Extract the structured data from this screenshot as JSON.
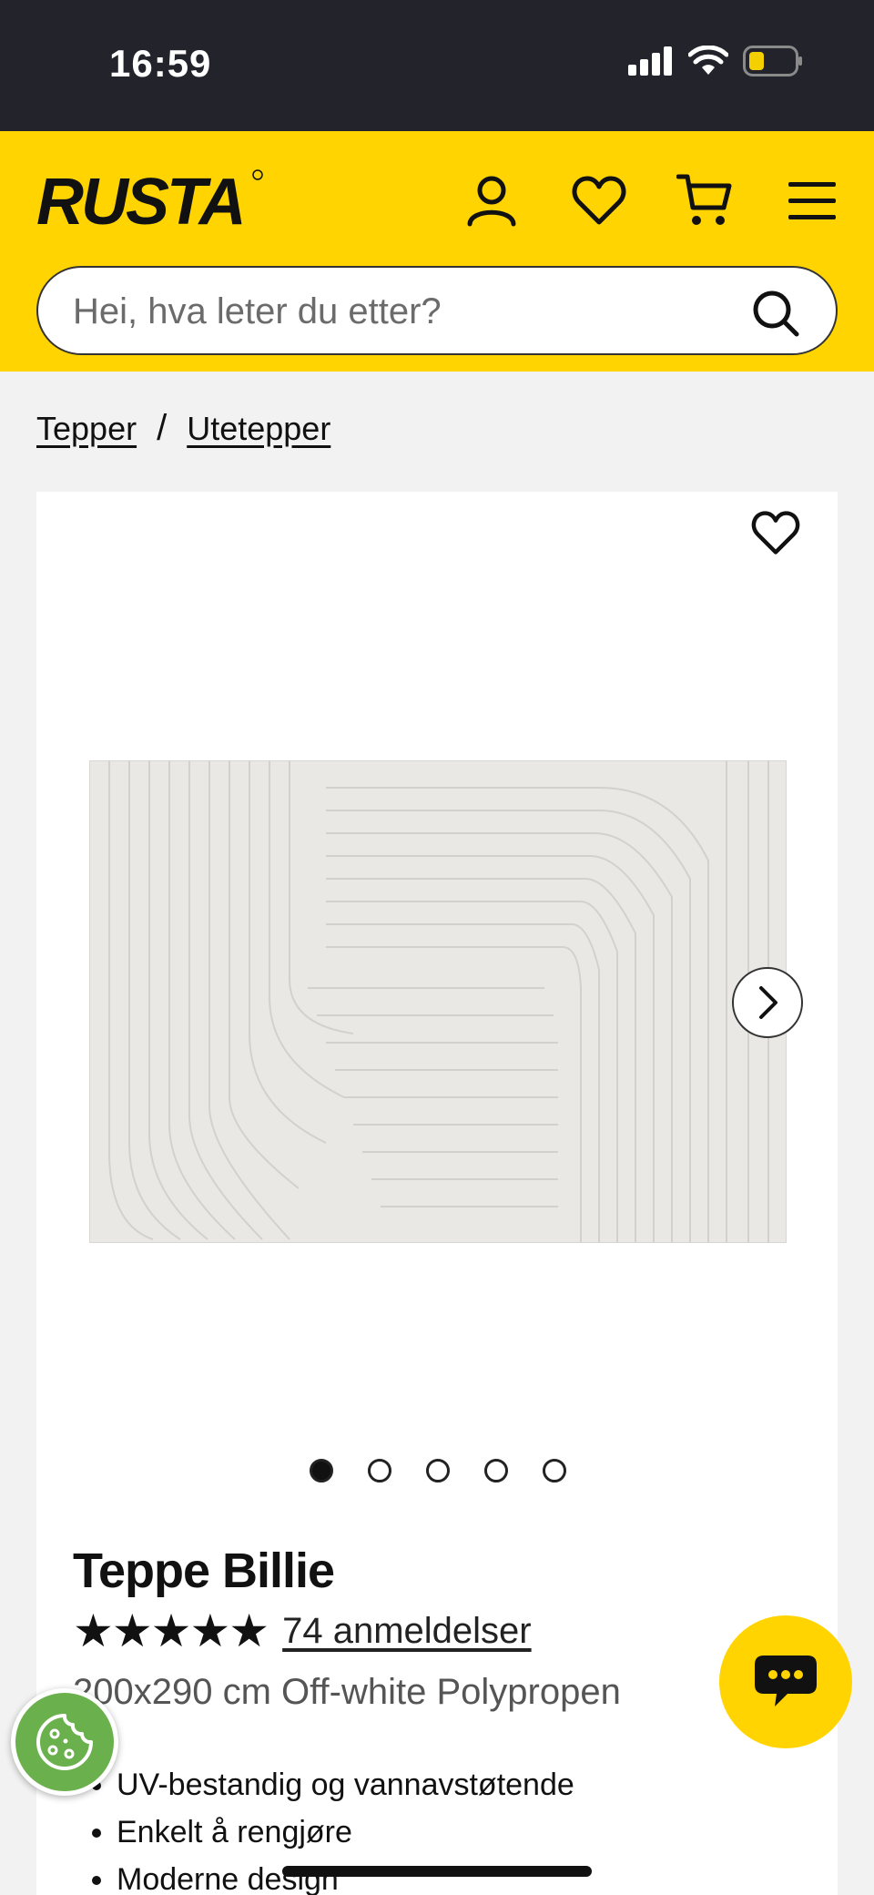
{
  "status_bar": {
    "time": "16:59"
  },
  "header": {
    "logo_text": "RUSTA",
    "icons": [
      "account-icon",
      "heart-icon",
      "cart-icon",
      "menu-icon"
    ],
    "brand_color": "#ffd400"
  },
  "search": {
    "placeholder": "Hei, hva leter du etter?",
    "value": ""
  },
  "breadcrumb": {
    "items": [
      "Tepper",
      "Utetepper"
    ],
    "separator": "/"
  },
  "gallery": {
    "image_count": 5,
    "active_index": 1
  },
  "product": {
    "title": "Teppe Billie",
    "rating_stars": "★★★★★",
    "rating": 5,
    "reviews_label": "74 anmeldelser",
    "variant": "200x290 cm Off-white Polypropen",
    "features": [
      "UV-bestandig og vannavstøtende",
      "Enkelt å rengjøre",
      "Moderne design"
    ]
  },
  "colors": {
    "accent": "#ffd400",
    "status_bar": "#23232b",
    "cookie": "#6ab04c"
  }
}
